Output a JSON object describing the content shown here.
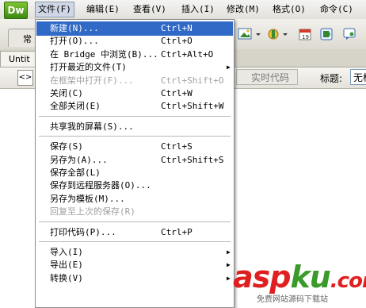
{
  "app": {
    "logo_text": "Dw"
  },
  "menubar": [
    {
      "label": "文件(F)",
      "open": true
    },
    {
      "label": "编辑(E)"
    },
    {
      "label": "查看(V)"
    },
    {
      "label": "插入(I)"
    },
    {
      "label": "修改(M)"
    },
    {
      "label": "格式(O)"
    },
    {
      "label": "命令(C)"
    }
  ],
  "toolbar": {
    "tab_label": "常"
  },
  "doc": {
    "tab_label": "Untit",
    "live_code_label": "实时代码",
    "title_label": "标题:",
    "title_value": "无标"
  },
  "file_menu": {
    "items": [
      {
        "label": "新建(N)...",
        "shortcut": "Ctrl+N",
        "highlighted": true
      },
      {
        "label": "打开(O)...",
        "shortcut": "Ctrl+O"
      },
      {
        "label": "在 Bridge 中浏览(B)...",
        "shortcut": "Ctrl+Alt+O"
      },
      {
        "label": "打开最近的文件(T)",
        "submenu": true
      },
      {
        "label": "在框架中打开(F)...",
        "shortcut": "Ctrl+Shift+O",
        "disabled": true
      },
      {
        "label": "关闭(C)",
        "shortcut": "Ctrl+W"
      },
      {
        "label": "全部关闭(E)",
        "shortcut": "Ctrl+Shift+W"
      },
      {
        "separator": true
      },
      {
        "label": "共享我的屏幕(S)..."
      },
      {
        "separator": true
      },
      {
        "label": "保存(S)",
        "shortcut": "Ctrl+S"
      },
      {
        "label": "另存为(A)...",
        "shortcut": "Ctrl+Shift+S"
      },
      {
        "label": "保存全部(L)"
      },
      {
        "label": "保存到远程服务器(O)..."
      },
      {
        "label": "另存为模板(M)..."
      },
      {
        "label": "回复至上次的保存(R)",
        "disabled": true
      },
      {
        "separator": true
      },
      {
        "label": "打印代码(P)...",
        "shortcut": "Ctrl+P"
      },
      {
        "separator": true
      },
      {
        "label": "导入(I)",
        "submenu": true
      },
      {
        "label": "导出(E)",
        "submenu": true
      },
      {
        "label": "转换(V)",
        "submenu": true
      }
    ]
  },
  "watermark": {
    "part1": "asp",
    "part2": "ku",
    "part3": ".com",
    "sub": "免费网站源码下载站"
  },
  "colors": {
    "highlight": "#3169c6",
    "wm_red": "#e02020",
    "wm_green": "#3a9a2a"
  }
}
